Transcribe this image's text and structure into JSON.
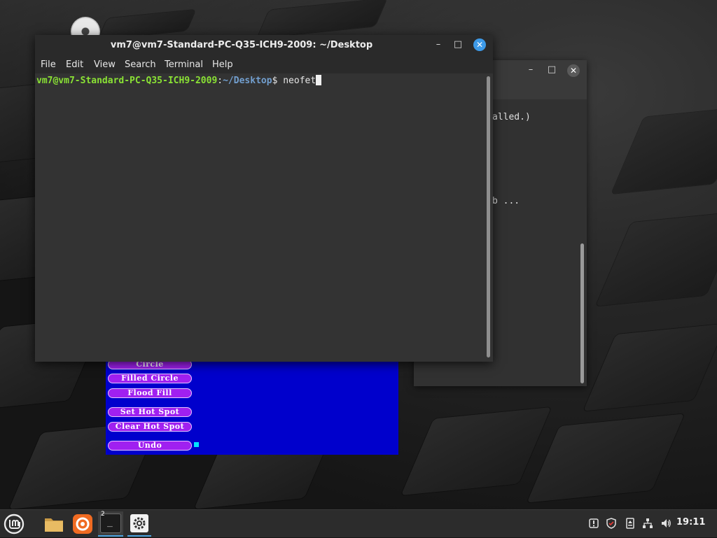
{
  "terminal": {
    "title": "vm7@vm7-Standard-PC-Q35-ICH9-2009: ~/Desktop",
    "menu": [
      "File",
      "Edit",
      "View",
      "Search",
      "Terminal",
      "Help"
    ],
    "prompt_user_host": "vm7@vm7-Standard-PC-Q35-ICH9-2009",
    "prompt_sep": ":",
    "prompt_path": "~/Desktop",
    "prompt_symbol": "$ ",
    "command": "neofet"
  },
  "background_terminal": {
    "lines": [
      "alled.)",
      "b ..."
    ]
  },
  "paint_app": {
    "buttons": [
      "Circle",
      "Filled Circle",
      "Flood Fill",
      "Set Hot Spot",
      "Clear Hot Spot",
      "Undo"
    ]
  },
  "taskbar": {
    "clock": "19:11",
    "terminal_workspace_badge": "2",
    "terminal_glyph": "_"
  },
  "icons": {
    "desktop": "disc-icon",
    "taskbar": [
      "mint-menu-icon",
      "files-icon",
      "firefox-icon",
      "terminal-icon",
      "settings-icon"
    ],
    "tray": [
      "update-manager-icon",
      "shield-icon",
      "removable-drive-icon",
      "network-icon",
      "volume-icon"
    ]
  },
  "colors": {
    "paint_background": "#0000cc",
    "paint_button": "#a020f0",
    "prompt_user": "#8ae234",
    "prompt_path": "#729fcf",
    "close_button": "#3d9ae8"
  }
}
